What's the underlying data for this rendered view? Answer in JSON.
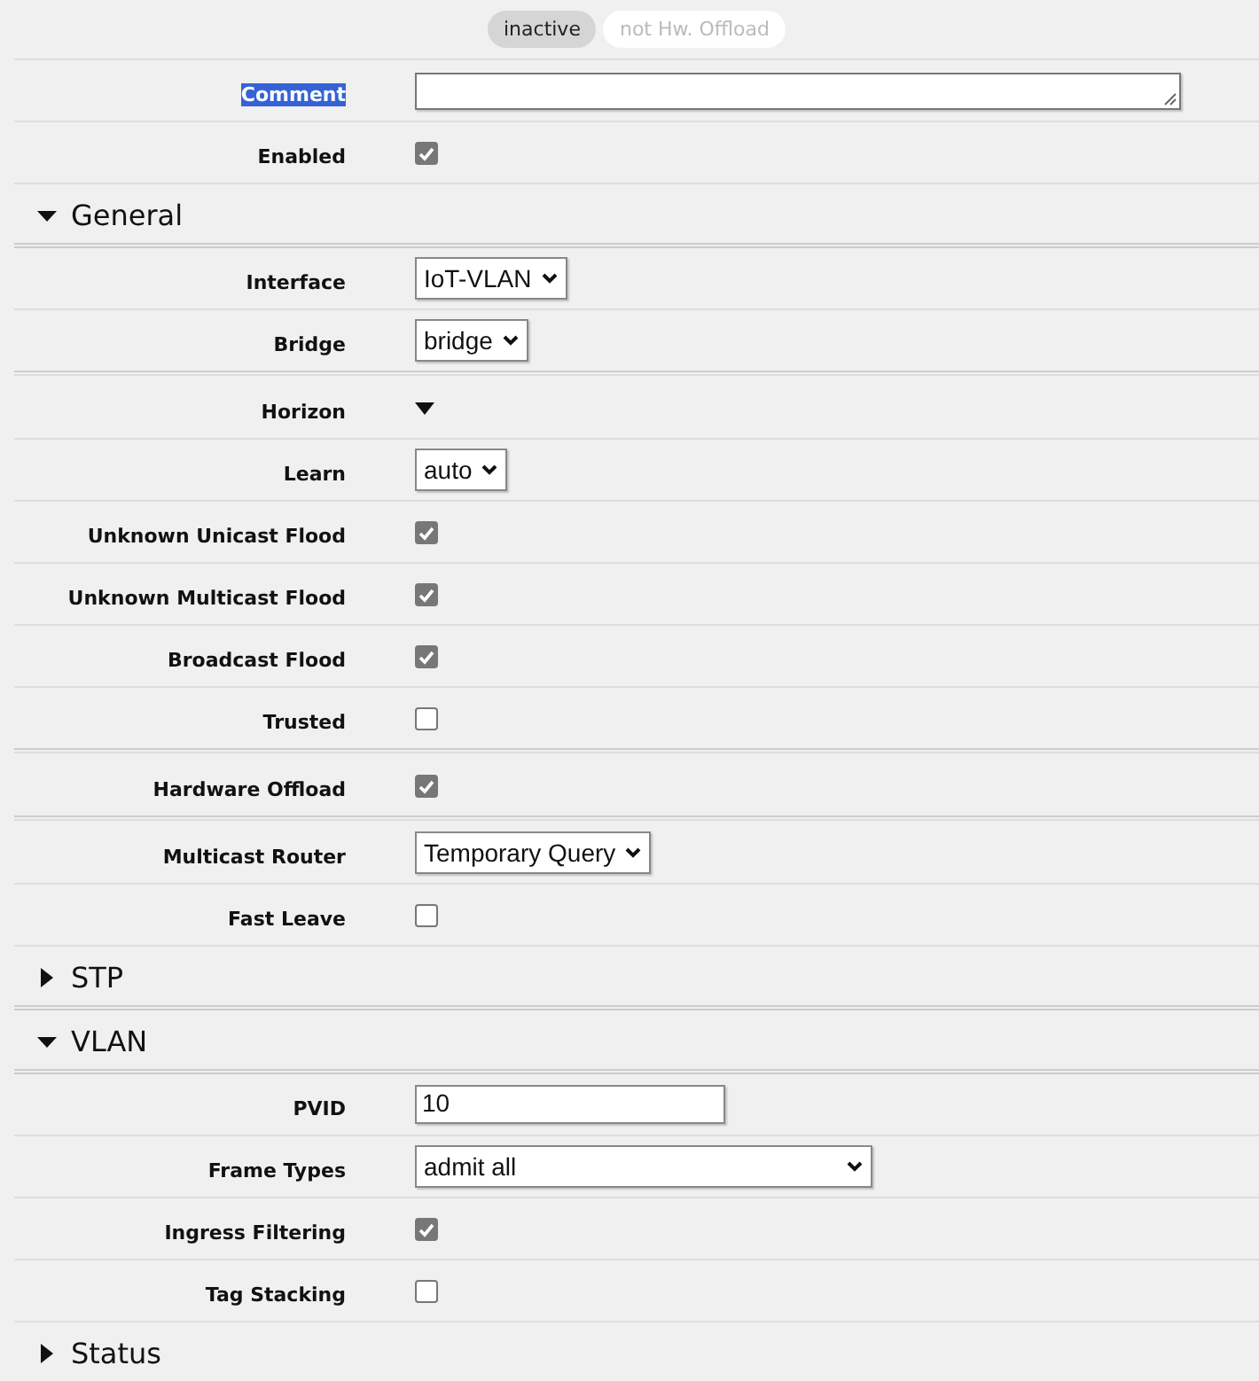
{
  "badges": [
    {
      "label": "inactive",
      "active": true
    },
    {
      "label": "not Hw. Offload",
      "active": false
    }
  ],
  "fields": [
    {
      "label": "Comment",
      "kind": "textarea",
      "highlighted": true
    },
    {
      "label": "Enabled",
      "kind": "checkbox",
      "checked": true
    }
  ],
  "sections": [
    {
      "title": "General",
      "expanded": true,
      "groups": [
        [
          {
            "label": "Interface",
            "kind": "select",
            "value": "IoT-VLAN"
          },
          {
            "label": "Bridge",
            "kind": "select",
            "value": "bridge"
          }
        ],
        [
          {
            "label": "Horizon",
            "kind": "expander"
          },
          {
            "label": "Learn",
            "kind": "select",
            "value": "auto"
          },
          {
            "label": "Unknown Unicast Flood",
            "kind": "checkbox",
            "checked": true
          },
          {
            "label": "Unknown Multicast Flood",
            "kind": "checkbox",
            "checked": true
          },
          {
            "label": "Broadcast Flood",
            "kind": "checkbox",
            "checked": true
          },
          {
            "label": "Trusted",
            "kind": "checkbox",
            "checked": false
          }
        ],
        [
          {
            "label": "Hardware Offload",
            "kind": "checkbox",
            "checked": true
          }
        ],
        [
          {
            "label": "Multicast Router",
            "kind": "select",
            "value": "Temporary Query"
          },
          {
            "label": "Fast Leave",
            "kind": "checkbox",
            "checked": false
          }
        ]
      ]
    },
    {
      "title": "STP",
      "expanded": false
    },
    {
      "title": "VLAN",
      "expanded": true,
      "groups": [
        [
          {
            "label": "PVID",
            "kind": "text",
            "value": "10"
          },
          {
            "label": "Frame Types",
            "kind": "wide-select",
            "value": "admit all"
          },
          {
            "label": "Ingress Filtering",
            "kind": "checkbox",
            "checked": true
          },
          {
            "label": "Tag Stacking",
            "kind": "checkbox",
            "checked": false
          }
        ]
      ]
    },
    {
      "title": "Status",
      "expanded": false
    }
  ]
}
